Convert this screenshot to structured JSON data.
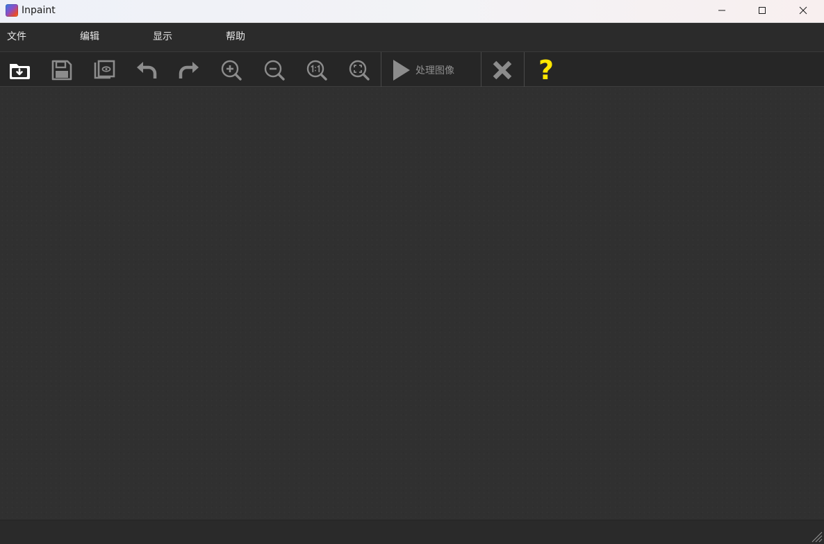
{
  "window": {
    "title": "Inpaint",
    "icon": "inpaint-app-icon",
    "controls": [
      "minimize-icon",
      "maximize-icon",
      "close-icon"
    ]
  },
  "menu": {
    "file": "文件",
    "edit": "编辑",
    "view": "显示",
    "help": "帮助"
  },
  "toolbar": {
    "process_label": "处理图像",
    "icons": {
      "open": "open-folder-icon",
      "save": "save-icon",
      "preview": "preview-icon",
      "undo": "undo-icon",
      "redo": "redo-icon",
      "zoom_in": "zoom-in-icon",
      "zoom_out": "zoom-out-icon",
      "zoom_actual": "zoom-1-1-icon",
      "zoom_fit": "zoom-fit-icon",
      "process": "play-icon",
      "cancel": "cancel-x-icon",
      "help": "help-question-icon"
    },
    "help_glyph": "?"
  },
  "colors": {
    "background": "#303030",
    "toolbar": "#262626",
    "icon_inactive": "#8c8c8c",
    "icon_active": "#ffffff",
    "help_yellow": "#ffe600"
  }
}
